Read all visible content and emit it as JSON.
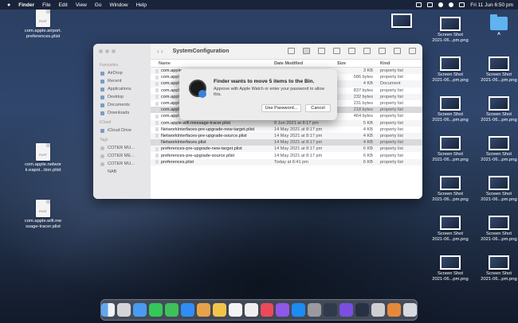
{
  "menubar": {
    "app": "Finder",
    "items": [
      "File",
      "Edit",
      "View",
      "Go",
      "Window",
      "Help"
    ],
    "clock": "Fri 11 Jun  6:50 pm"
  },
  "desktop": {
    "left_icons": [
      {
        "label": "com.apple.airport.\npreferences.plist",
        "badge": "PLIST"
      },
      {
        "label": "com.apple.networ\nk.eapoi...tion.plist",
        "badge": "PLIST"
      },
      {
        "label": "com.apple.wifi.me\nssage-tracer.plist",
        "badge": "PLIST"
      }
    ],
    "folder_label": "A",
    "screenshot_label": "Screen Shot\n2021-06...pm.png"
  },
  "finder": {
    "title": "SystemConfiguration",
    "sidebar": {
      "favourites_header": "Favourites",
      "favourites": [
        "AirDrop",
        "Recent",
        "Applications",
        "Desktop",
        "Documents",
        "Downloads"
      ],
      "icloud_header": "iCloud",
      "icloud": [
        "iCloud Drive"
      ],
      "tags_header": "Tags",
      "tags": [
        "COTER MU...",
        "COTER ME...",
        "COTER MU...",
        "NAB"
      ]
    },
    "columns": {
      "name": "Name",
      "date": "Date Modified",
      "size": "Size",
      "kind": "Kind"
    },
    "rows": [
      {
        "name": "com.apple...",
        "date": "",
        "size": "3 KB",
        "kind": "property list"
      },
      {
        "name": "com.apple...",
        "date": "",
        "size": "586 bytes",
        "kind": "property list"
      },
      {
        "name": "com.apple...",
        "date": "",
        "size": "4 KB",
        "kind": "Document"
      },
      {
        "name": "com.apple...",
        "date": "",
        "size": "837 bytes",
        "kind": "property list"
      },
      {
        "name": "com.apple...",
        "date": "",
        "size": "232 bytes",
        "kind": "property list"
      },
      {
        "name": "com.apple...",
        "date": "",
        "size": "231 bytes",
        "kind": "property list"
      },
      {
        "name": "com.apple.network.eapolclient.configuration.plist",
        "date": "9 May 2020 at 6:00 pm",
        "size": "218 bytes",
        "kind": "property list"
      },
      {
        "name": "com.apple.smb.server.plist",
        "date": "12 Sep 2020 at 11:03 pm",
        "size": "464 bytes",
        "kind": "property list"
      },
      {
        "name": "com.apple.wifi.message-tracer.plist",
        "date": "8 Jun 2021 at 8:17 pm",
        "size": "5 KB",
        "kind": "property list"
      },
      {
        "name": "NetworkInterfaces-pre-upgrade-new-target.plist",
        "date": "14 May 2021 at 8:17 pm",
        "size": "4 KB",
        "kind": "property list"
      },
      {
        "name": "NetworkInterfaces-pre-upgrade-source.plist",
        "date": "14 May 2021 at 8:17 pm",
        "size": "4 KB",
        "kind": "property list"
      },
      {
        "name": "NetworkInterfaces.plist",
        "date": "14 May 2021 at 8:17 pm",
        "size": "4 KB",
        "kind": "property list"
      },
      {
        "name": "preferences-pre-upgrade-new-target.plist",
        "date": "14 May 2021 at 8:17 pm",
        "size": "6 KB",
        "kind": "property list"
      },
      {
        "name": "preferences-pre-upgrade-source.plist",
        "date": "14 May 2021 at 8:17 pm",
        "size": "6 KB",
        "kind": "property list"
      },
      {
        "name": "preferences.plist",
        "date": "Today at 6:41 pm",
        "size": "6 KB",
        "kind": "property list"
      }
    ]
  },
  "dialog": {
    "message": "Finder wants to move 5 items to the Bin.",
    "detail": "Approve with Apple Watch or enter your password to allow this.",
    "use_password": "Use Password...",
    "cancel": "Cancel"
  },
  "colors": {
    "selection": "#d9d9dc",
    "accent": "#3d82d9",
    "folder": "#5fb3f0"
  }
}
